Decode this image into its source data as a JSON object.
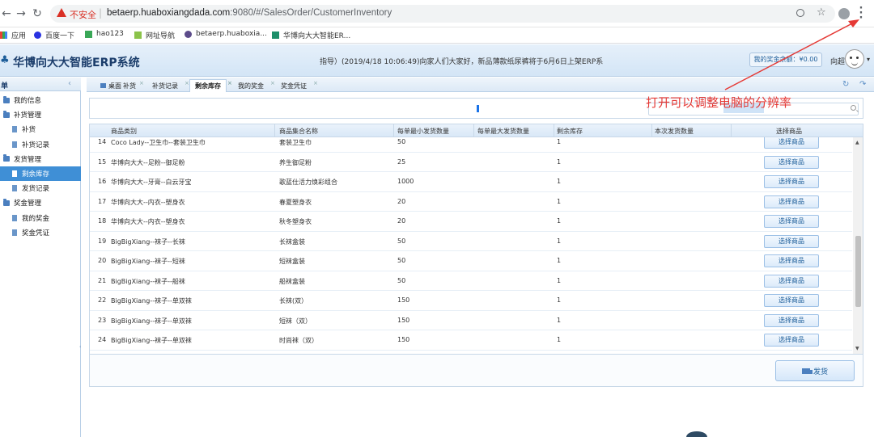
{
  "browser": {
    "security_label": "不安全",
    "url_host": "betaerp.huaboxiangdada.com",
    "url_rest": ":9080/#/SalesOrder/CustomerInventory",
    "bookmarks": [
      "应用",
      "百度一下",
      "hao123",
      "网址导航",
      "betaerp.huaboxia...",
      "华博向大大智能ER..."
    ]
  },
  "app": {
    "title": "华博向大大智能ERP系统",
    "notice": "指导）(2019/4/18 10:06:49)向家人们大家好，新品薄款纸尿裤将于6月6日上架ERP系",
    "bonus": "我的奖金余额：¥0.00",
    "user": "向超"
  },
  "sidebar": {
    "header": "单",
    "items": [
      {
        "label": "我的信息",
        "level": 1,
        "type": "folder"
      },
      {
        "label": "补货管理",
        "level": 1,
        "type": "folder"
      },
      {
        "label": "补货",
        "level": 2,
        "type": "doc"
      },
      {
        "label": "补货记录",
        "level": 2,
        "type": "doc"
      },
      {
        "label": "发货管理",
        "level": 1,
        "type": "folder"
      },
      {
        "label": "剩余库存",
        "level": 2,
        "type": "doc",
        "active": true
      },
      {
        "label": "发货记录",
        "level": 2,
        "type": "doc"
      },
      {
        "label": "奖金管理",
        "level": 1,
        "type": "folder"
      },
      {
        "label": "我的奖金",
        "level": 2,
        "type": "doc"
      },
      {
        "label": "奖金凭证",
        "level": 2,
        "type": "doc"
      }
    ]
  },
  "tabs": [
    "桌面",
    "补货",
    "补货记录",
    "剩余库存",
    "我的奖金",
    "奖金凭证"
  ],
  "grid": {
    "columns": [
      "商品类别",
      "商品集合名称",
      "每单最小发货数量",
      "每单最大发货数量",
      "剩余库存",
      "本次发货数量",
      "选择商品"
    ],
    "rows": [
      {
        "no": "14",
        "category": "Coco Lady--卫生巾--套装卫生巾",
        "name": "套装卫生巾",
        "min": "50",
        "stock": "1"
      },
      {
        "no": "15",
        "category": "华博向大大--足粉--御足粉",
        "name": "养生御足粉",
        "min": "25",
        "stock": "1"
      },
      {
        "no": "16",
        "category": "华博向大大--牙膏--白云牙宝",
        "name": "歌蓝仕活力焕彩组合",
        "min": "1000",
        "stock": "1"
      },
      {
        "no": "17",
        "category": "华博向大大--内衣--塑身衣",
        "name": "春夏塑身衣",
        "min": "20",
        "stock": "1"
      },
      {
        "no": "18",
        "category": "华博向大大--内衣--塑身衣",
        "name": "秋冬塑身衣",
        "min": "20",
        "stock": "1"
      },
      {
        "no": "19",
        "category": "BigBigXiang--袜子--长袜",
        "name": "长袜盒装",
        "min": "50",
        "stock": "1"
      },
      {
        "no": "20",
        "category": "BigBigXiang--袜子--短袜",
        "name": "短袜盒装",
        "min": "50",
        "stock": "1"
      },
      {
        "no": "21",
        "category": "BigBigXiang--袜子--船袜",
        "name": "船袜盒装",
        "min": "50",
        "stock": "1"
      },
      {
        "no": "22",
        "category": "BigBigXiang--袜子--单双袜",
        "name": "长袜(双）",
        "min": "150",
        "stock": "1"
      },
      {
        "no": "23",
        "category": "BigBigXiang--袜子--单双袜",
        "name": "短袜（双）",
        "min": "150",
        "stock": "1"
      },
      {
        "no": "24",
        "category": "BigBigXiang--袜子--单双袜",
        "name": "时尚袜（双）",
        "min": "150",
        "stock": "1"
      }
    ],
    "select_label": "选择商品"
  },
  "footer": {
    "ship_label": "发货"
  },
  "annotation": {
    "text": "打开可以调整电脑的分辨率",
    "color": "#e53935"
  }
}
